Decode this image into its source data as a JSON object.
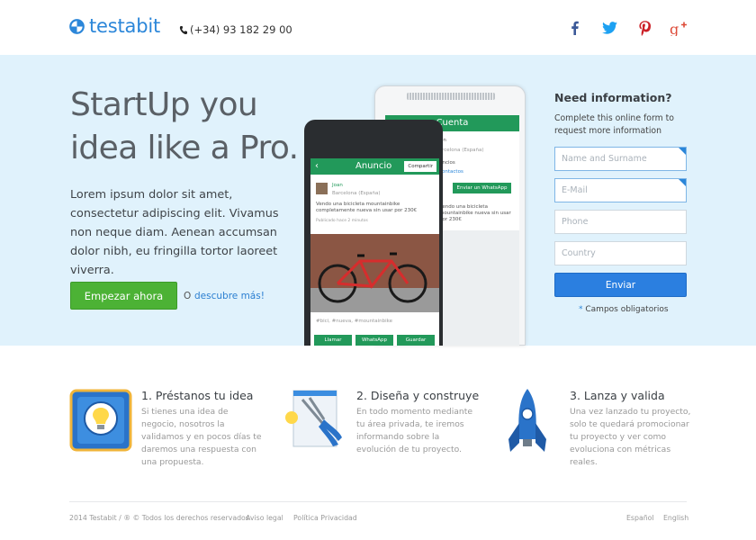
{
  "header": {
    "logo_text": "testabit",
    "phone_number": "(+34) 93 182 29 00",
    "social": [
      {
        "icon": "facebook-icon",
        "color": "#3b5998"
      },
      {
        "icon": "twitter-icon",
        "color": "#1da1f2"
      },
      {
        "icon": "pinterest-icon",
        "color": "#cb2027"
      },
      {
        "icon": "google-plus-icon",
        "color": "#dd4b39"
      }
    ]
  },
  "hero": {
    "title": "StartUp you idea like a Pro.",
    "body": "Lorem ipsum dolor sit amet, consectetur adipiscing elit. Vivamus non neque diam. Aenean accumsan dolor nibh, eu fringilla tortor laoreet viverra.",
    "primary_button": "Empezar ahora",
    "or_text": "O",
    "secondary_link": "descubre más!",
    "background_color": "#e0f2fc"
  },
  "phone_mock": {
    "back_title": "Cuenta",
    "back_location": "Barcelona (España)",
    "back_text_1": "uncios",
    "back_text_2": "contactos",
    "back_button": "Enviar un WhatsApp",
    "back_item": "Vendo una bicicleta mountainbike nueva sin usar por 230€",
    "front_title": "Anuncio",
    "front_share": "Compartir",
    "user_name": "Joan",
    "user_location": "Barcelona (España)",
    "ad_text": "Vendo una bicicleta mountainbike completamente nueva sin usar por 230€",
    "posted": "Publicado hace 2 minutos",
    "tags": "#bici, #nueva, #mountainbike",
    "buttons": [
      "Llamar",
      "WhatsApp",
      "Guardar"
    ]
  },
  "form": {
    "title": "Need information?",
    "subtitle": "Complete this online form to request more information",
    "fields": [
      {
        "placeholder": "Name and Surname"
      },
      {
        "placeholder": "E-Mail"
      },
      {
        "placeholder": "Phone"
      },
      {
        "placeholder": "Country"
      }
    ],
    "submit": "Enviar",
    "required_star": "*",
    "required_note": "Campos obligatorios"
  },
  "features": [
    {
      "icon": "lightbulb-badge-icon",
      "title": "1. Préstanos tu idea",
      "body": "Si tienes una idea de negocio, nosotros la validamos y en pocos días te daremos una respuesta con una propuesta."
    },
    {
      "icon": "pliers-tools-icon",
      "title": "2. Diseña y construye",
      "body": "En todo momento mediante tu área privada, te iremos informando sobre la evolución de tu proyecto."
    },
    {
      "icon": "rocket-icon",
      "title": "3. Lanza y valida",
      "body": "Una vez lanzado tu proyecto, solo te quedará promocionar tu proyecto y ver como evoluciona con métricas reales."
    }
  ],
  "footer": {
    "copyright": "2014 Testabit / ® © Todos los derechos reservados",
    "legal_link": "Aviso legal",
    "privacy_link": "Política Privacidad",
    "lang_es": "Español",
    "lang_en": "English"
  }
}
